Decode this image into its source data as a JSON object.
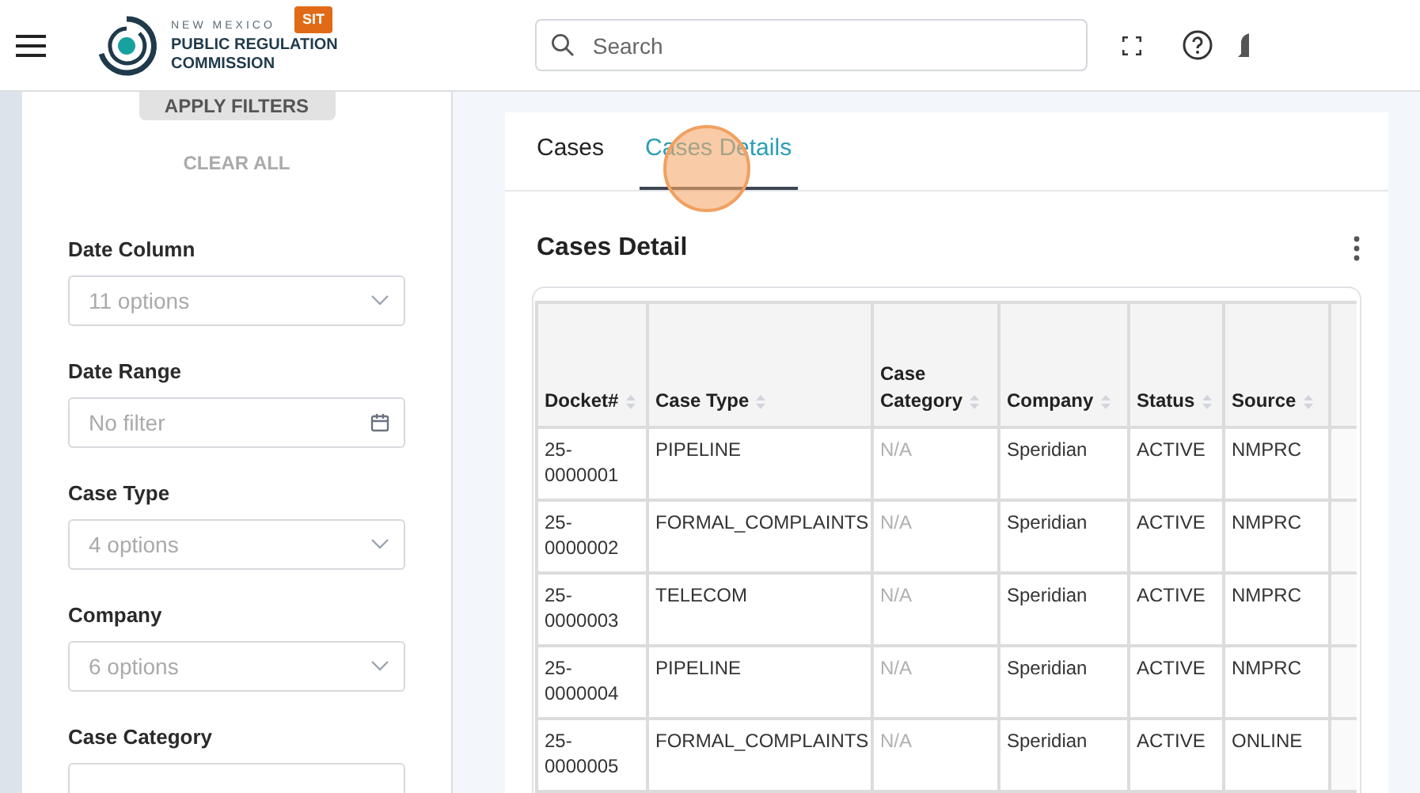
{
  "header": {
    "logo": {
      "line_1": "NEW MEXICO",
      "line_2": "PUBLIC REGULATION",
      "line_3": "COMMISSION"
    },
    "env_badge": "SIT",
    "search": {
      "placeholder": "Search"
    }
  },
  "sidebar": {
    "apply_button": "APPLY FILTERS",
    "clear_button": "CLEAR ALL",
    "filters": [
      {
        "label": "Date Column",
        "kind": "select",
        "placeholder": "11 options"
      },
      {
        "label": "Date Range",
        "kind": "date",
        "placeholder": "No filter"
      },
      {
        "label": "Case Type",
        "kind": "select",
        "placeholder": "4 options"
      },
      {
        "label": "Company",
        "kind": "select",
        "placeholder": "6 options"
      },
      {
        "label": "Case Category",
        "kind": "select"
      }
    ]
  },
  "tabs": [
    {
      "label": "Cases",
      "selected": false
    },
    {
      "label": "Cases Details",
      "selected": true
    }
  ],
  "panel": {
    "title": "Cases Detail"
  },
  "table": {
    "columns": [
      "Docket#",
      "Case Type",
      "Case Category",
      "Company",
      "Status",
      "Source"
    ],
    "rows": [
      {
        "cells": [
          "25-0000001",
          "PIPELINE",
          "N/A",
          "Speridian",
          "ACTIVE",
          "NMPRC"
        ]
      },
      {
        "cells": [
          "25-0000002",
          "FORMAL_COMPLAINTS",
          "N/A",
          "Speridian",
          "ACTIVE",
          "NMPRC"
        ]
      },
      {
        "cells": [
          "25-0000003",
          "TELECOM",
          "N/A",
          "Speridian",
          "ACTIVE",
          "NMPRC"
        ]
      },
      {
        "cells": [
          "25-0000004",
          "PIPELINE",
          "N/A",
          "Speridian",
          "ACTIVE",
          "NMPRC"
        ]
      },
      {
        "cells": [
          "25-0000005",
          "FORMAL_COMPLAINTS",
          "N/A",
          "Speridian",
          "ACTIVE",
          "ONLINE"
        ]
      }
    ]
  }
}
